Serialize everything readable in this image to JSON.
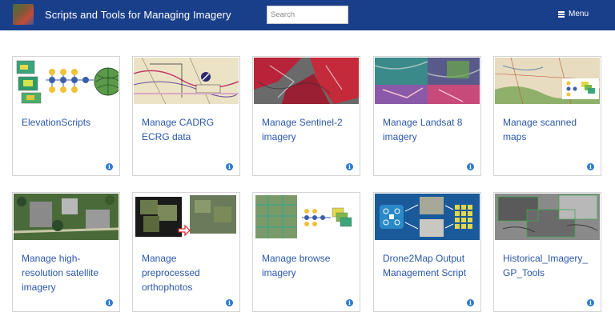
{
  "header": {
    "title": "Scripts and Tools for Managing Imagery",
    "search_placeholder": "Search",
    "menu_label": "Menu",
    "logo_icon": "imagery-thumbnail-logo",
    "menu_icon": "hamburger-icon",
    "background_color": "#1a3f8a"
  },
  "cards": [
    {
      "label": "ElevationScripts",
      "info_glyph": "i",
      "thumb": "elevation-workflow-diagram"
    },
    {
      "label": "Manage CADRG ECRG data",
      "info_glyph": "i",
      "thumb": "aeronautical-chart"
    },
    {
      "label": "Manage Sentinel-2 imagery",
      "info_glyph": "i",
      "thumb": "red-terrain-imagery"
    },
    {
      "label": "Manage Landsat 8 imagery",
      "info_glyph": "i",
      "thumb": "landsat-mosaic"
    },
    {
      "label": "Manage scanned maps",
      "info_glyph": "i",
      "thumb": "scanned-topo-map"
    },
    {
      "label": "Manage high-resolution satellite imagery",
      "info_glyph": "i",
      "thumb": "satellite-aerial-view"
    },
    {
      "label": "Manage preprocessed orthophotos",
      "info_glyph": "i",
      "thumb": "orthophoto-tiles"
    },
    {
      "label": "Manage browse imagery",
      "info_glyph": "i",
      "thumb": "browse-imagery-workflow"
    },
    {
      "label": "Drone2Map Output Management Script",
      "info_glyph": "i",
      "thumb": "drone-workflow-diagram"
    },
    {
      "label": "Historical_Imagery_ GP_Tools",
      "info_glyph": "i",
      "thumb": "historical-bw-imagery"
    }
  ],
  "colors": {
    "link": "#2b57a8",
    "info": "#2b7bd0",
    "card_border": "#d4d4d4"
  }
}
